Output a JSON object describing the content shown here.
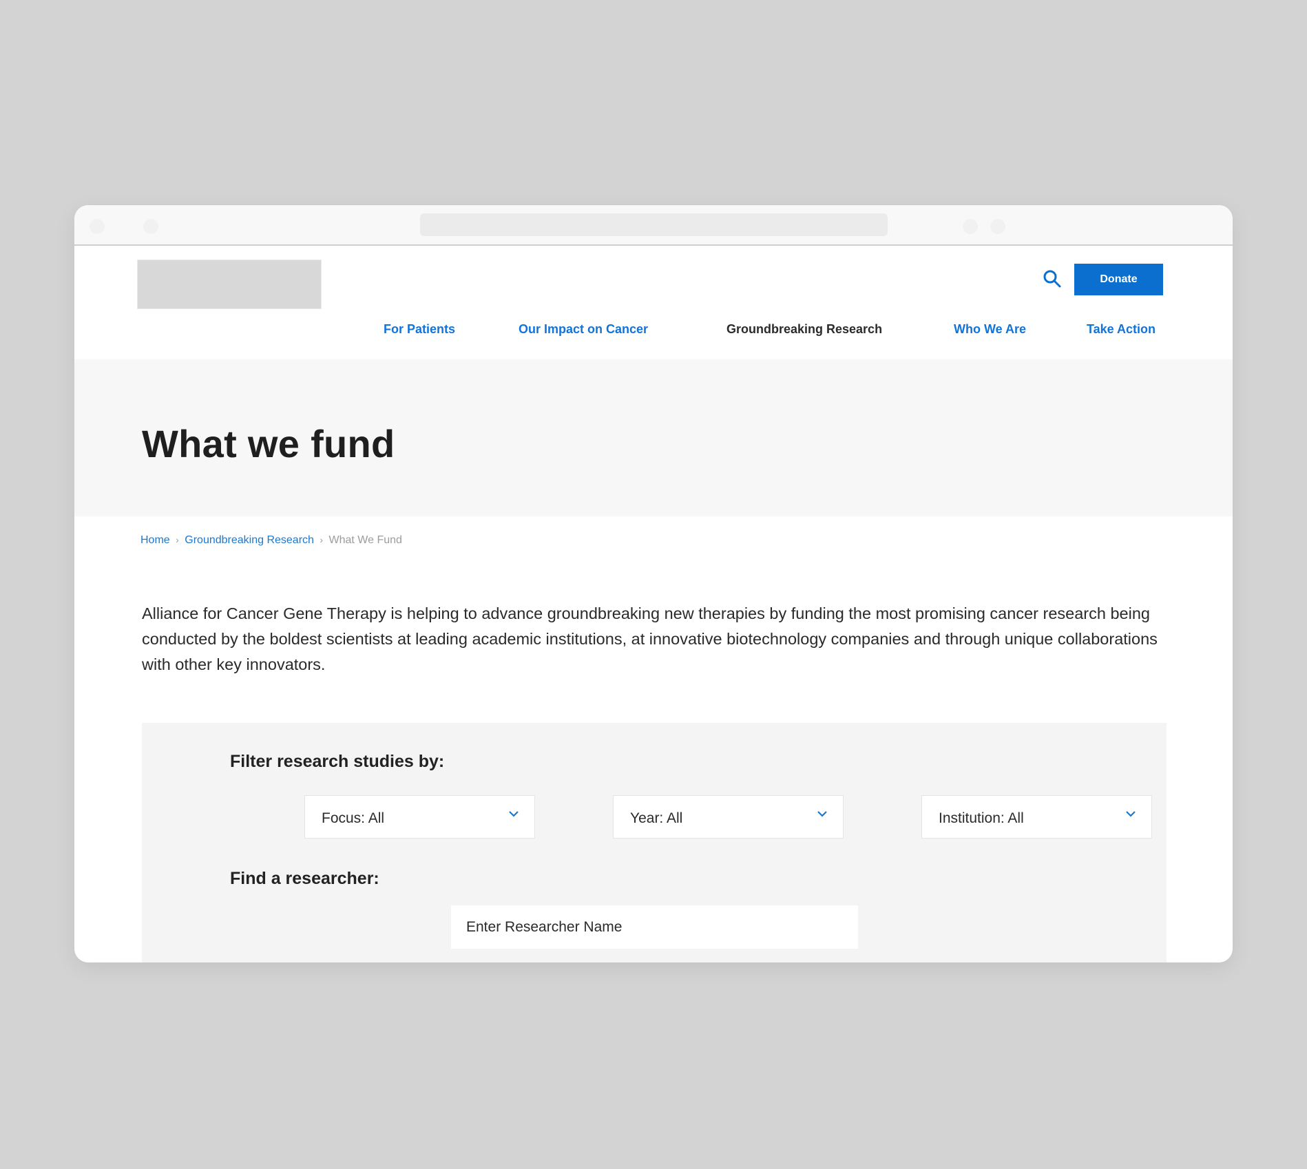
{
  "header": {
    "donate_label": "Donate",
    "search_icon": "search-icon"
  },
  "nav": {
    "items": [
      {
        "label": "For Patients",
        "active": false
      },
      {
        "label": "Our Impact on Cancer",
        "active": false
      },
      {
        "label": "Groundbreaking Research",
        "active": true
      },
      {
        "label": "Who We Are",
        "active": false
      },
      {
        "label": "Take Action",
        "active": false
      }
    ]
  },
  "hero": {
    "title": "What we fund"
  },
  "breadcrumb": {
    "items": [
      "Home",
      "Groundbreaking Research"
    ],
    "separator": "›",
    "current": "What We Fund"
  },
  "intro": {
    "text": "Alliance for Cancer Gene Therapy is helping to advance groundbreaking new therapies by funding the most promising cancer research being conducted by the boldest scientists at leading academic institutions, at innovative biotechnology companies and through unique collaborations with other key innovators."
  },
  "filters": {
    "title": "Filter research studies by:",
    "selects": [
      {
        "label": "Focus: All"
      },
      {
        "label": "Year: All"
      },
      {
        "label": "Institution: All"
      }
    ],
    "find_title": "Find a researcher:",
    "researcher_placeholder": "Enter Researcher Name",
    "researcher_value": ""
  },
  "colors": {
    "accent": "#0a6fce",
    "link": "#1273d8",
    "hero_bg": "#f7f7f7",
    "panel_bg": "#f4f4f4"
  }
}
